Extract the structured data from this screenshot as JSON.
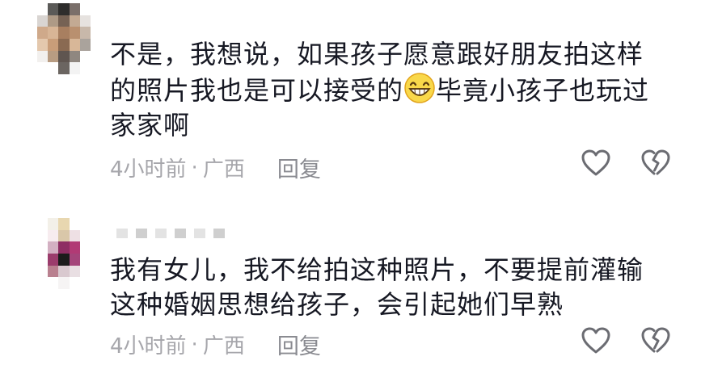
{
  "comments": [
    {
      "text_part1": "不是，我想说，如果孩子愿意跟好朋友拍这样\n的照片我也是可以接受的",
      "text_part2": "毕竟小孩子也玩过\n家家啊",
      "time": "4小时前",
      "location": "广西",
      "reply_label": "回复"
    },
    {
      "text_part1": "我有女儿，我不给拍这种照片，不要提前灌输\n这种婚姻思想给孩子，会引起她们早熟",
      "time": "4小时前",
      "location": "广西",
      "reply_label": "回复"
    }
  ],
  "meta_separator": "·",
  "icons": {
    "like": "heart-outline-icon",
    "dislike": "broken-heart-icon",
    "emoji": "grinning-face-emoji"
  },
  "colors": {
    "text": "#161823",
    "meta": "#a6a6ab",
    "icon_stroke": "#6b6c72"
  }
}
